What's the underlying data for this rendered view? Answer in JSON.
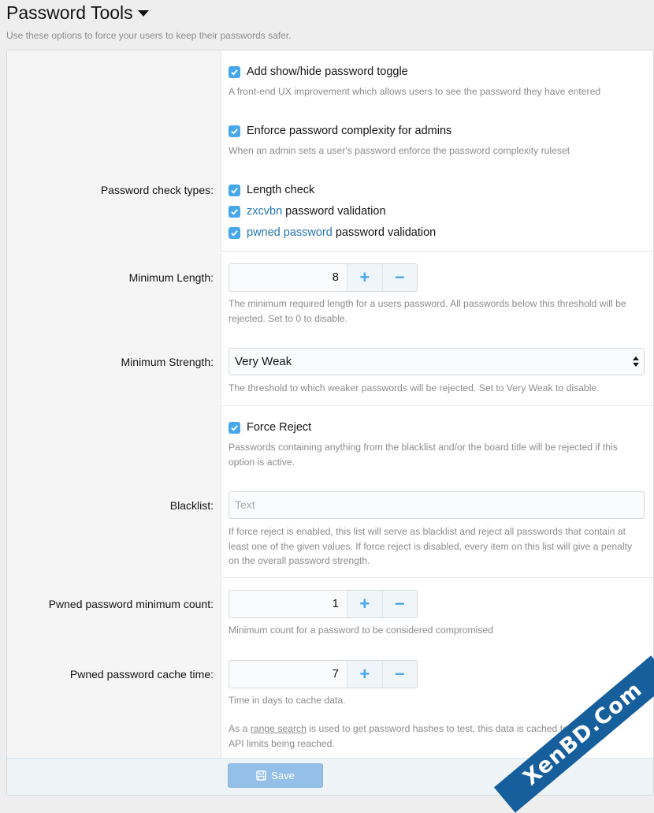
{
  "header": {
    "title": "Password Tools",
    "description": "Use these options to force your users to keep their passwords safer."
  },
  "options": {
    "show_hide": {
      "label": "Add show/hide password toggle",
      "hint": "A front-end UX improvement which allows users to see the password they have entered",
      "checked": true
    },
    "enforce_admin": {
      "label": "Enforce password complexity for admins",
      "hint": "When an admin sets a user's password enforce the password complexity ruleset",
      "checked": true
    },
    "check_types": {
      "label": "Password check types:",
      "items": [
        {
          "prefix": "",
          "link": "",
          "text": "Length check",
          "checked": true
        },
        {
          "prefix": "",
          "link": "zxcvbn",
          "text": " password validation",
          "checked": true
        },
        {
          "prefix": "",
          "link": "pwned password",
          "text": " password validation",
          "checked": true
        }
      ]
    },
    "min_length": {
      "label": "Minimum Length:",
      "value": "8",
      "plus": "+",
      "minus": "−",
      "hint": "The minimum required length for a users password. All passwords below this threshold will be rejected. Set to 0 to disable."
    },
    "min_strength": {
      "label": "Minimum Strength:",
      "value": "Very Weak",
      "hint": "The threshold to which weaker passwords will be rejected. Set to Very Weak to disable."
    },
    "force_reject": {
      "label": "Force Reject",
      "hint": "Passwords containing anything from the blacklist and/or the board title will be rejected if this option is active.",
      "checked": true
    },
    "blacklist": {
      "label": "Blacklist:",
      "placeholder": "Text",
      "hint": "If force reject is enabled, this list will serve as blacklist and reject all passwords that contain at least one of the given values. If force reject is disabled, every item on this list will give a penalty on the overall password strength."
    },
    "pwned_min": {
      "label": "Pwned password minimum count:",
      "value": "1",
      "plus": "+",
      "minus": "−",
      "hint": "Minimum count for a password to be considered compromised"
    },
    "pwned_cache": {
      "label": "Pwned password cache time:",
      "value": "7",
      "plus": "+",
      "minus": "−",
      "hint": "Time in days to cache data.",
      "note_prefix": "As a ",
      "note_link": "range search",
      "note_suffix": " is used to get password hashes to test, this data is cached to",
      "note_tail_visible": "API limits being reached."
    }
  },
  "footer": {
    "save_label": "Save"
  },
  "watermark": "XenBD.Com",
  "colors": {
    "accent": "#47a7eb",
    "link": "#2577b1",
    "save_button": "#94bfe8",
    "hint_text": "#8c8c8c"
  }
}
